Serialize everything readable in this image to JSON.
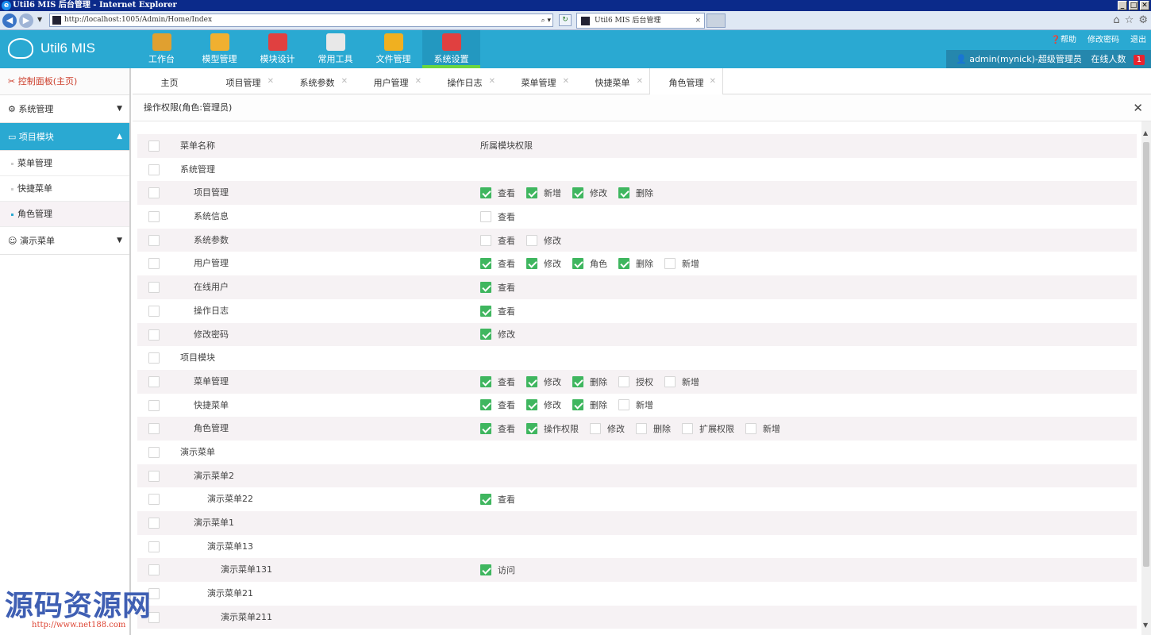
{
  "window": {
    "title": "Util6 MIS 后台管理 - Internet Explorer",
    "address": "http://localhost:1005/Admin/Home/Index",
    "tab_title": "Util6 MIS 后台管理"
  },
  "app": {
    "brand": "Util6 MIS",
    "nav": [
      {
        "label": "工作台",
        "icon": "workbench-icon",
        "color": "#e0a030"
      },
      {
        "label": "模型管理",
        "icon": "model-icon",
        "color": "#f0b030"
      },
      {
        "label": "模块设计",
        "icon": "module-design-icon",
        "color": "#e04040"
      },
      {
        "label": "常用工具",
        "icon": "printer-icon",
        "color": "#e8e8e8"
      },
      {
        "label": "文件管理",
        "icon": "folder-icon",
        "color": "#f0b020"
      },
      {
        "label": "系统设置",
        "icon": "tools-icon",
        "color": "#e04040"
      }
    ],
    "links": {
      "help": "帮助",
      "change_password": "修改密码",
      "logout": "退出"
    },
    "user": {
      "name": "admin(mynick)-超级管理员",
      "online_label": "在线人数",
      "online_count": "1"
    }
  },
  "sidebar": {
    "home": "控制面板(主页)",
    "groups": [
      {
        "label": "系统管理"
      },
      {
        "label": "项目模块",
        "items": [
          "菜单管理",
          "快捷菜单",
          "角色管理"
        ]
      },
      {
        "label": "演示菜单"
      }
    ]
  },
  "tabs": [
    "主页",
    "项目管理",
    "系统参数",
    "用户管理",
    "操作日志",
    "菜单管理",
    "快捷菜单",
    "角色管理"
  ],
  "panel": {
    "title": "操作权限(角色:管理员)",
    "header": {
      "name": "菜单名称",
      "perms": "所属模块权限"
    },
    "rows": [
      {
        "name": "系统管理",
        "level": 0,
        "perms": []
      },
      {
        "name": "项目管理",
        "level": 1,
        "perms": [
          {
            "l": "查看",
            "on": true
          },
          {
            "l": "新增",
            "on": true
          },
          {
            "l": "修改",
            "on": true
          },
          {
            "l": "删除",
            "on": true
          }
        ]
      },
      {
        "name": "系统信息",
        "level": 1,
        "perms": [
          {
            "l": "查看",
            "on": false
          }
        ]
      },
      {
        "name": "系统参数",
        "level": 1,
        "perms": [
          {
            "l": "查看",
            "on": false
          },
          {
            "l": "修改",
            "on": false
          }
        ]
      },
      {
        "name": "用户管理",
        "level": 1,
        "perms": [
          {
            "l": "查看",
            "on": true
          },
          {
            "l": "修改",
            "on": true
          },
          {
            "l": "角色",
            "on": true
          },
          {
            "l": "删除",
            "on": true
          },
          {
            "l": "新增",
            "on": false
          }
        ]
      },
      {
        "name": "在线用户",
        "level": 1,
        "perms": [
          {
            "l": "查看",
            "on": true
          }
        ]
      },
      {
        "name": "操作日志",
        "level": 1,
        "perms": [
          {
            "l": "查看",
            "on": true
          }
        ]
      },
      {
        "name": "修改密码",
        "level": 1,
        "perms": [
          {
            "l": "修改",
            "on": true
          }
        ]
      },
      {
        "name": "项目模块",
        "level": 0,
        "perms": []
      },
      {
        "name": "菜单管理",
        "level": 1,
        "perms": [
          {
            "l": "查看",
            "on": true
          },
          {
            "l": "修改",
            "on": true
          },
          {
            "l": "删除",
            "on": true
          },
          {
            "l": "授权",
            "on": false
          },
          {
            "l": "新增",
            "on": false
          }
        ]
      },
      {
        "name": "快捷菜单",
        "level": 1,
        "perms": [
          {
            "l": "查看",
            "on": true
          },
          {
            "l": "修改",
            "on": true
          },
          {
            "l": "删除",
            "on": true
          },
          {
            "l": "新增",
            "on": false
          }
        ]
      },
      {
        "name": "角色管理",
        "level": 1,
        "perms": [
          {
            "l": "查看",
            "on": true
          },
          {
            "l": "操作权限",
            "on": true
          },
          {
            "l": "修改",
            "on": false
          },
          {
            "l": "删除",
            "on": false
          },
          {
            "l": "扩展权限",
            "on": false
          },
          {
            "l": "新增",
            "on": false
          }
        ]
      },
      {
        "name": "演示菜单",
        "level": 0,
        "perms": []
      },
      {
        "name": "演示菜单2",
        "level": 1,
        "perms": []
      },
      {
        "name": "演示菜单22",
        "level": 2,
        "perms": [
          {
            "l": "查看",
            "on": true
          }
        ]
      },
      {
        "name": "演示菜单1",
        "level": 1,
        "perms": []
      },
      {
        "name": "演示菜单13",
        "level": 2,
        "perms": []
      },
      {
        "name": "演示菜单131",
        "level": 3,
        "perms": [
          {
            "l": "访问",
            "on": true
          }
        ]
      },
      {
        "name": "演示菜单21",
        "level": 2,
        "perms": []
      },
      {
        "name": "演示菜单211",
        "level": 3,
        "perms": []
      }
    ]
  },
  "watermark": {
    "text": "源码资源网",
    "url": "http://www.net188.com"
  }
}
